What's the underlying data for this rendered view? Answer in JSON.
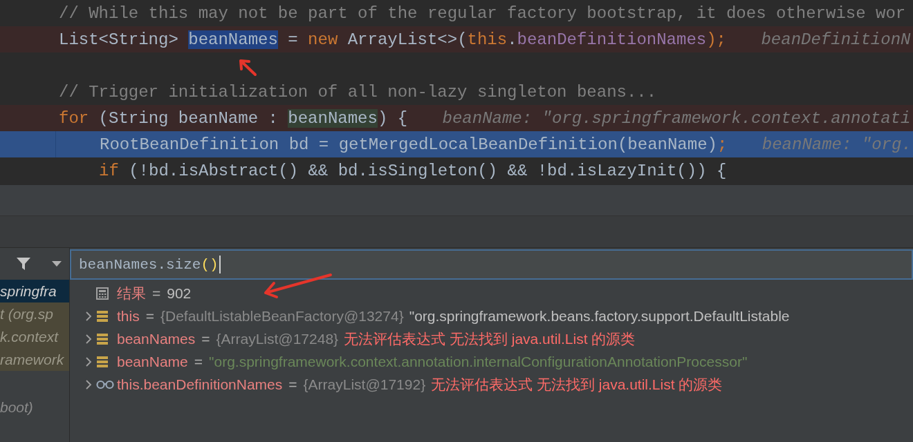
{
  "editor": {
    "lines": [
      {
        "kind": "normal",
        "indented": false,
        "tokens": [
          {
            "text": "// While this may not be part of the regular factory bootstrap, it does otherwise wor",
            "kind": "comment"
          }
        ]
      },
      {
        "kind": "breakpoint",
        "indented": false,
        "tokens": [
          {
            "text": "List<String> ",
            "kind": "plain"
          },
          {
            "text": "beanNames",
            "kind": "selected"
          },
          {
            "text": " = ",
            "kind": "plain"
          },
          {
            "text": "new",
            "kind": "keyword"
          },
          {
            "text": " ArrayList<>(",
            "kind": "plain"
          },
          {
            "text": "this",
            "kind": "keyword"
          },
          {
            "text": ".",
            "kind": "plain"
          },
          {
            "text": "beanDefinitionNames",
            "kind": "field"
          },
          {
            "text": ");",
            "kind": "punct"
          }
        ],
        "hint": "beanDefinitionN"
      },
      {
        "kind": "blank",
        "indented": false
      },
      {
        "kind": "normal",
        "indented": false,
        "tokens": [
          {
            "text": "// Trigger initialization of all non-lazy singleton beans...",
            "kind": "comment"
          }
        ]
      },
      {
        "kind": "breakpoint",
        "indented": false,
        "tokens": [
          {
            "text": "for",
            "kind": "keyword"
          },
          {
            "text": " (String beanName : ",
            "kind": "plain"
          },
          {
            "text": "beanNames",
            "kind": "usage"
          },
          {
            "text": ") {",
            "kind": "plain"
          }
        ],
        "hint": "beanName: \"org.springframework.context.annotati"
      },
      {
        "kind": "current",
        "indented": true,
        "tokens": [
          {
            "text": "RootBeanDefinition bd = getMergedLocalBeanDefinition(beanName)",
            "kind": "plain"
          },
          {
            "text": ";",
            "kind": "punct"
          }
        ],
        "hint": "beanName: \"org."
      },
      {
        "kind": "normal",
        "indented": true,
        "tokens": [
          {
            "text": "if",
            "kind": "keyword"
          },
          {
            "text": " (!bd.isAbstract() && bd.isSingleton() && !bd.isLazyInit()) {",
            "kind": "plain"
          }
        ]
      }
    ]
  },
  "frames": [
    {
      "text": "springfra",
      "selected": true,
      "library": false
    },
    {
      "text": "t (org.sp",
      "selected": false,
      "library": true
    },
    {
      "text": "k.context",
      "selected": false,
      "library": true
    },
    {
      "text": "ramework",
      "selected": false,
      "library": true
    },
    {
      "text": "boot)",
      "selected": false,
      "library": false
    }
  ],
  "expression": {
    "tokens": [
      {
        "text": "beanNames.size",
        "kind": "plain"
      },
      {
        "text": "()",
        "kind": "paren"
      }
    ]
  },
  "variables": [
    {
      "kind": "result",
      "expandable": false,
      "name": "结果",
      "equals": "=",
      "value": [
        {
          "text": "902",
          "kind": "plain"
        }
      ]
    },
    {
      "kind": "field",
      "expandable": true,
      "name": "this",
      "equals": "=",
      "value": [
        {
          "text": "{DefaultListableBeanFactory@13274}",
          "kind": "object"
        },
        {
          "text": "\"org.springframework.beans.factory.support.DefaultListable",
          "kind": "plain"
        }
      ]
    },
    {
      "kind": "field",
      "expandable": true,
      "name": "beanNames",
      "equals": "=",
      "value": [
        {
          "text": "{ArrayList@17248}",
          "kind": "object"
        },
        {
          "text": "无法评估表达式 无法找到 java.util.List 的源类",
          "kind": "error"
        }
      ]
    },
    {
      "kind": "field",
      "expandable": true,
      "name": "beanName",
      "equals": "=",
      "value": [
        {
          "text": "\"org.springframework.context.annotation.internalConfigurationAnnotationProcessor\"",
          "kind": "string"
        }
      ]
    },
    {
      "kind": "watch",
      "expandable": true,
      "name": "this.beanDefinitionNames",
      "equals": "=",
      "value": [
        {
          "text": "{ArrayList@17192}",
          "kind": "object"
        },
        {
          "text": "无法评估表达式 无法找到 java.util.List 的源类",
          "kind": "error"
        }
      ]
    }
  ]
}
